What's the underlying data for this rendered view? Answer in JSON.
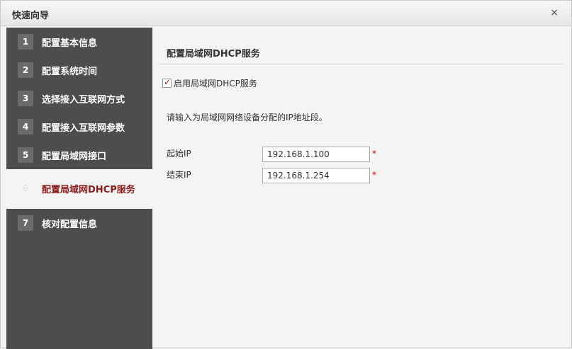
{
  "dialog": {
    "title": "快速向导",
    "close_symbol": "×"
  },
  "steps": [
    {
      "num": "1",
      "label": "配置基本信息"
    },
    {
      "num": "2",
      "label": "配置系统时间"
    },
    {
      "num": "3",
      "label": "选择接入互联网方式"
    },
    {
      "num": "4",
      "label": "配置接入互联网参数"
    },
    {
      "num": "5",
      "label": "配置局域网接口"
    },
    {
      "num": "6",
      "label": "配置局域网DHCP服务",
      "active": true
    },
    {
      "num": "7",
      "label": "核对配置信息"
    }
  ],
  "main": {
    "section_title": "配置局域网DHCP服务",
    "enable_dhcp_label": "启用局域网DHCP服务",
    "enable_dhcp_checked": true,
    "description": "请输入为局域网网络设备分配的IP地址段。",
    "start_ip_label": "起始IP",
    "start_ip_value": "192.168.1.100",
    "end_ip_label": "结束IP",
    "end_ip_value": "192.168.1.254",
    "required_mark": "*"
  },
  "colors": {
    "sidebar_bg": "#4d4d4d",
    "active_label": "#8b1a1a",
    "required": "#cc0000"
  }
}
